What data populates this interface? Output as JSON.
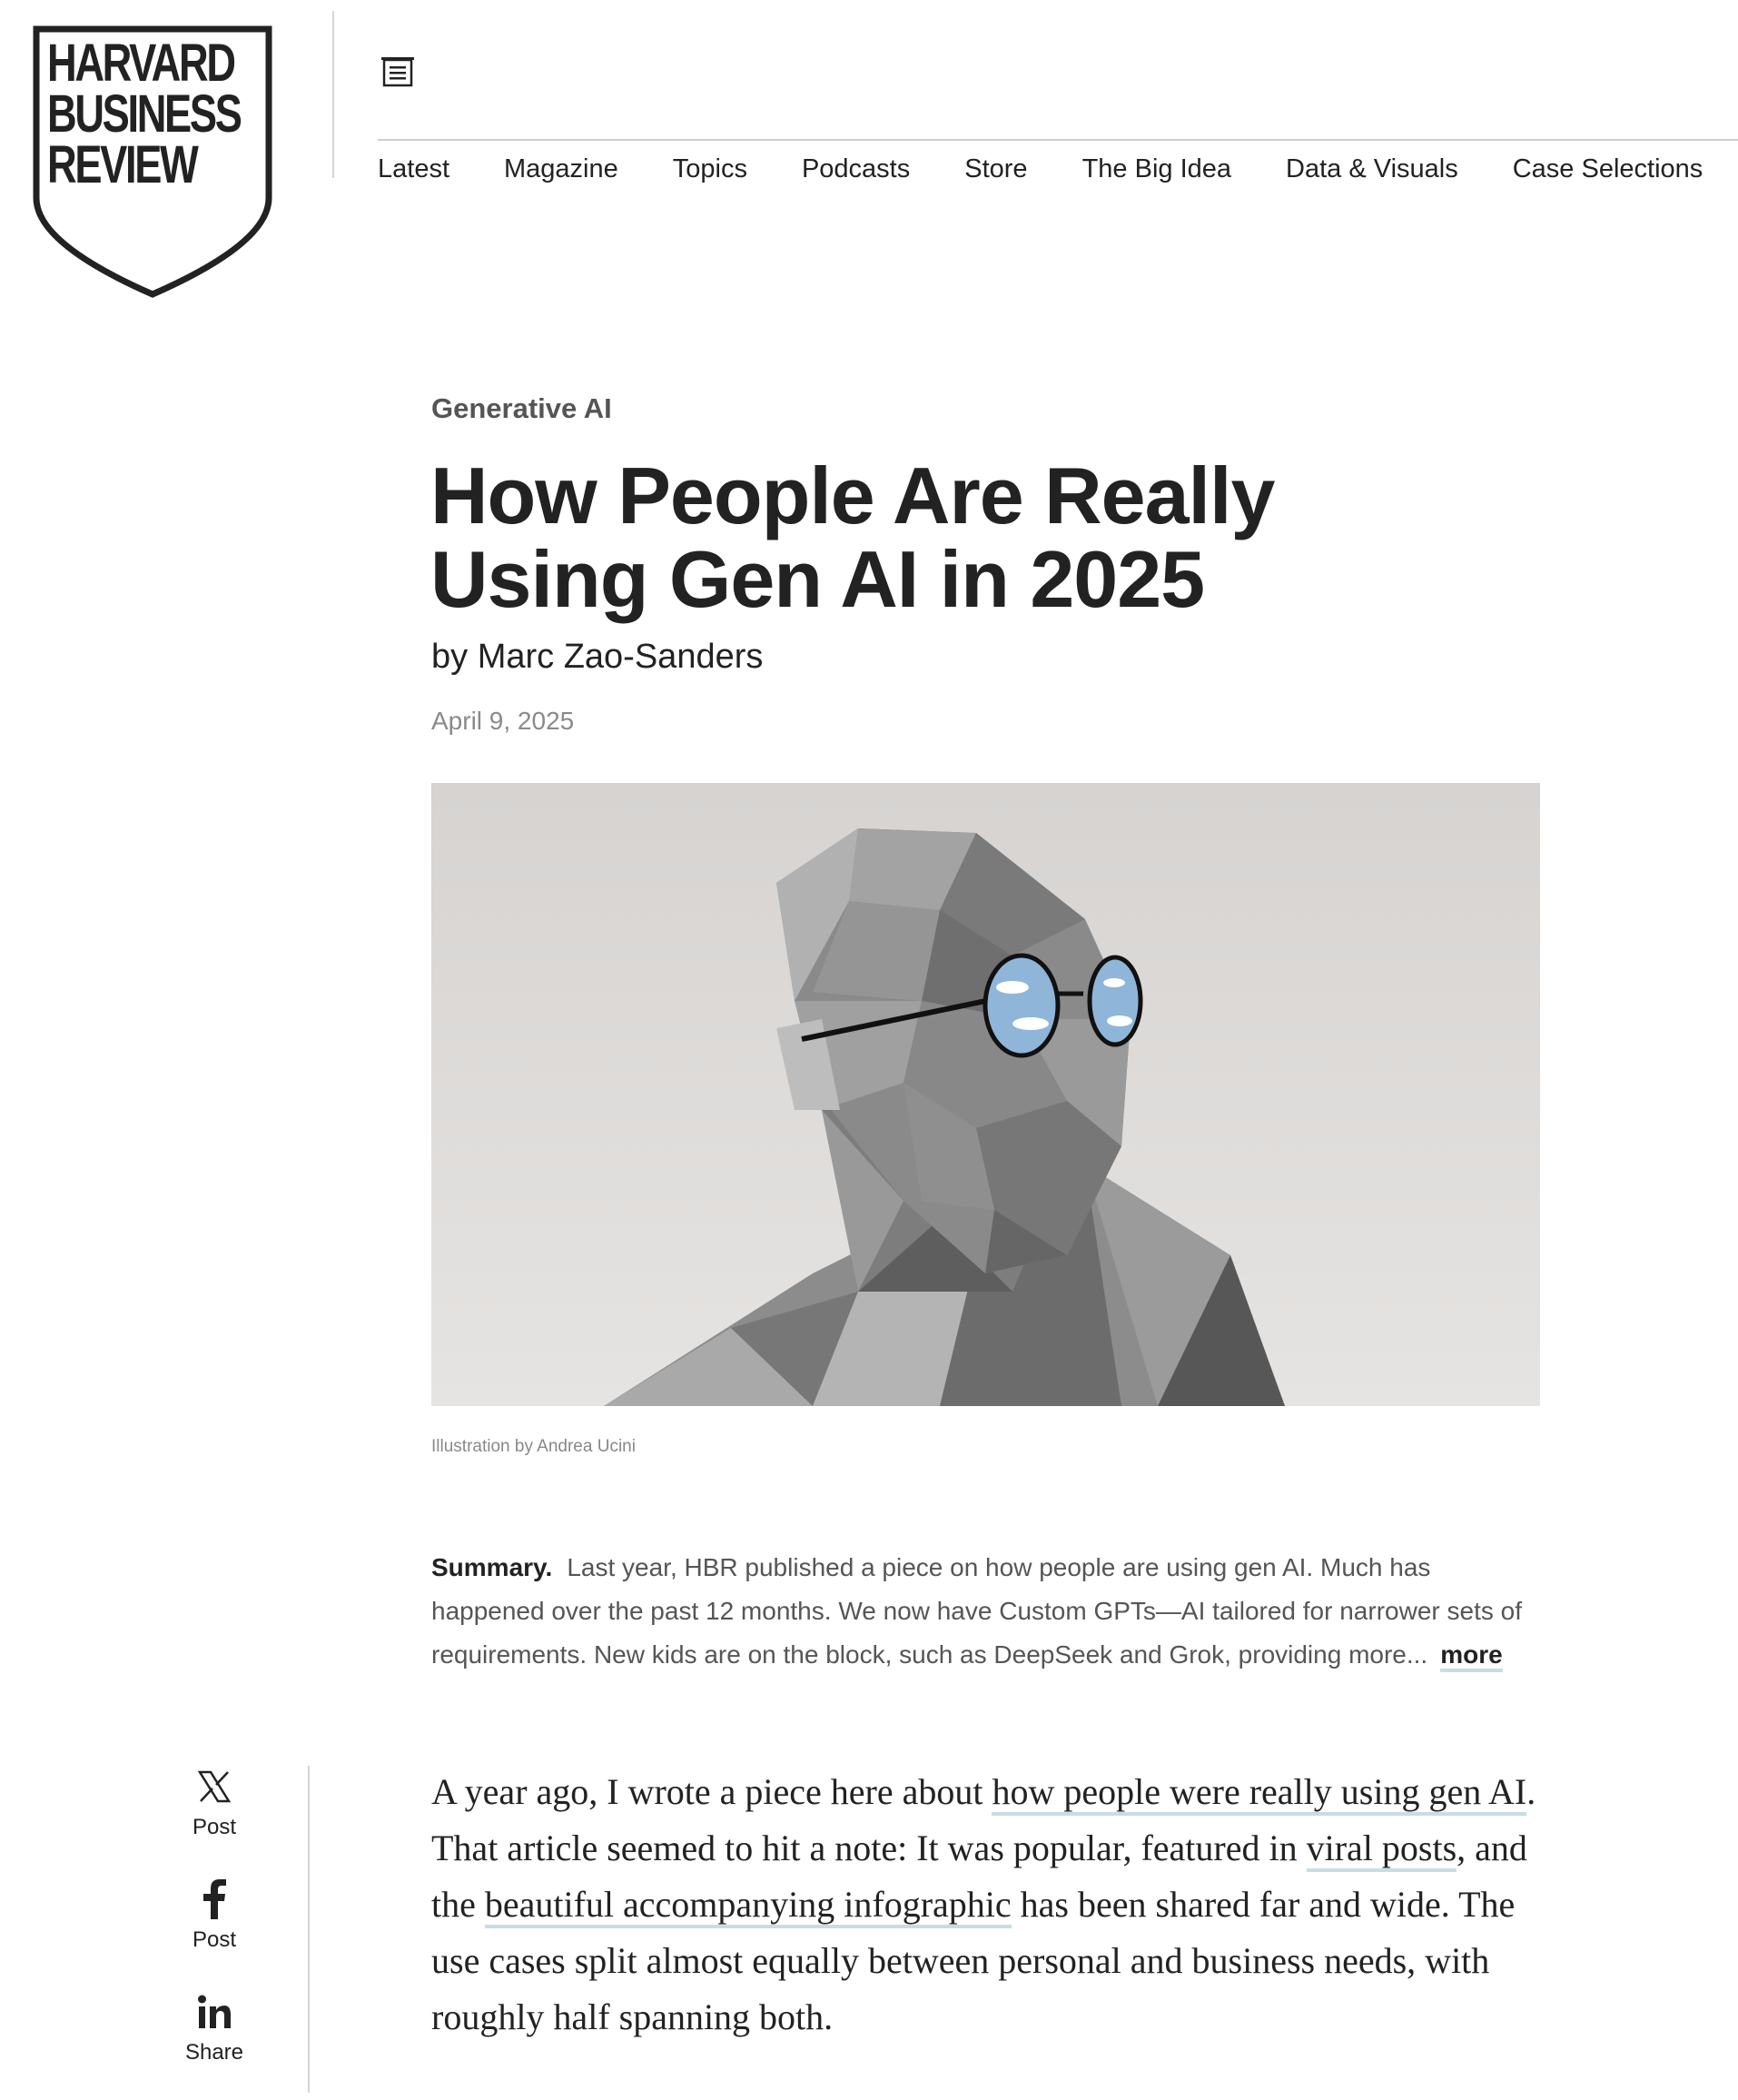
{
  "brand": {
    "logo_lines": [
      "HARVARD",
      "BUSINESS",
      "REVIEW"
    ]
  },
  "header": {
    "menu_icon": "menu-icon"
  },
  "nav": {
    "items": [
      "Latest",
      "Magazine",
      "Topics",
      "Podcasts",
      "Store",
      "The Big Idea",
      "Data & Visuals",
      "Case Selections"
    ]
  },
  "article": {
    "kicker": "Generative AI",
    "title": "How People Are Really Using Gen AI in 2025",
    "by_prefix": "by",
    "author": "Marc Zao-Sanders",
    "date": "April 9, 2025",
    "image_caption": "Illustration by Andrea Ucini",
    "summary": {
      "label": "Summary.",
      "text": "Last year, HBR published a piece on how people are using gen AI. Much has happened over the past 12 months. We now have Custom GPTs—AI tailored for narrower sets of requirements. New kids are on the block, such as DeepSeek and Grok, providing more...",
      "more_label": "more"
    },
    "body": {
      "t1": "A year ago, I wrote a piece here about ",
      "link1": "how people were really using gen AI",
      "t2": ". That article seemed to hit a note: It was popular, featured in ",
      "link2": "viral posts",
      "t3": ", and the ",
      "link3": "beautiful accompanying infographic",
      "t4": " has been shared far and wide. The use cases split almost equally between personal and business needs, with roughly half spanning both."
    }
  },
  "share": {
    "items": [
      {
        "icon": "x-icon",
        "label": "Post"
      },
      {
        "icon": "facebook-icon",
        "label": "Post"
      },
      {
        "icon": "linkedin-icon",
        "label": "Share"
      }
    ]
  },
  "colors": {
    "text": "#222222",
    "muted": "#8a8a8a",
    "link_underline": "#c8dde3"
  }
}
